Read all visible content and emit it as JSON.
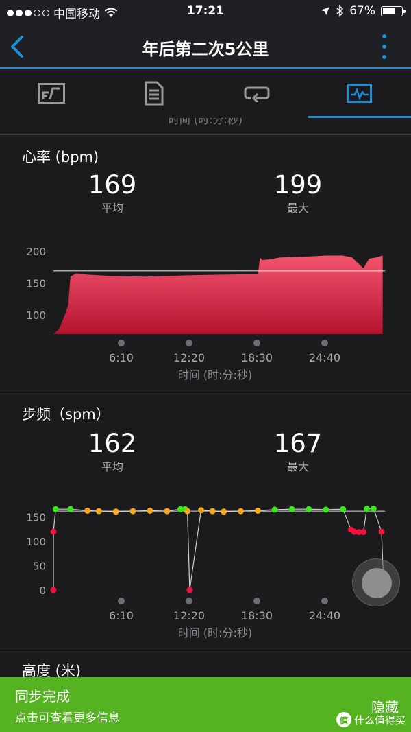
{
  "status_bar": {
    "carrier": "中国移动",
    "time": "17:21",
    "battery": "67%",
    "battery_level": 0.67,
    "icons": [
      "signal-dots-icon",
      "wifi-icon",
      "location-arrow-icon",
      "bluetooth-icon",
      "battery-icon"
    ]
  },
  "header": {
    "title": "年后第二次5公里",
    "back_icon": "chevron-left-icon",
    "more_icon": "more-vertical-icon",
    "accent_color": "#1a8fd8"
  },
  "tabs": [
    {
      "name": "overview",
      "icon": "overview-icon",
      "active": false
    },
    {
      "name": "details",
      "icon": "document-icon",
      "active": false
    },
    {
      "name": "laps",
      "icon": "loop-icon",
      "active": false
    },
    {
      "name": "charts",
      "icon": "chart-icon",
      "active": true
    }
  ],
  "partial_axis_label": "时间 (时:分:秒)",
  "heart_rate": {
    "title": "心率 (bpm)",
    "avg_value": "169",
    "avg_label": "平均",
    "max_value": "199",
    "max_label": "最大",
    "axis_label": "时间 (时:分:秒)"
  },
  "cadence": {
    "title": "步频（spm）",
    "avg_value": "162",
    "avg_label": "平均",
    "max_value": "167",
    "max_label": "最大",
    "axis_label": "时间 (时:分:秒)"
  },
  "elevation": {
    "title": "高度 (米)"
  },
  "banner": {
    "title": "同步完成",
    "subtitle": "点击可查看更多信息",
    "hide_label": "隐藏",
    "watermark": "什么值得买",
    "watermark_icon": "值",
    "background_color": "#55b322"
  },
  "chart_data": [
    {
      "type": "area",
      "title": "心率 (bpm)",
      "xlabel": "时间 (时:分:秒)",
      "ylabel": "",
      "x_ticks": [
        "6:10",
        "12:20",
        "18:30",
        "24:40"
      ],
      "y_ticks": [
        100,
        150,
        200
      ],
      "ylim": [
        70,
        215
      ],
      "xlim_minutes": [
        0,
        29.2
      ],
      "average_line": 169,
      "color": "#e8294f",
      "x_minutes": [
        0.0,
        0.5,
        1.0,
        1.3,
        1.5,
        2.0,
        3.0,
        5.0,
        8.0,
        10.0,
        12.0,
        15.0,
        18.0,
        18.2,
        18.4,
        19.0,
        20.0,
        22.0,
        24.0,
        25.5,
        26.3,
        27.3,
        27.8,
        28.4,
        29.0
      ],
      "values": [
        70,
        78,
        100,
        115,
        160,
        165,
        163,
        161,
        160,
        161,
        162,
        163,
        164,
        190,
        186,
        187,
        190,
        191,
        193,
        193,
        190,
        173,
        188,
        190,
        193
      ]
    },
    {
      "type": "scatter",
      "title": "步频（spm）",
      "xlabel": "时间 (时:分:秒)",
      "ylabel": "",
      "x_ticks": [
        "6:10",
        "12:20",
        "18:30",
        "24:40"
      ],
      "y_ticks": [
        0,
        50,
        100,
        150
      ],
      "ylim": [
        0,
        170
      ],
      "xlim_minutes": [
        0,
        29.2
      ],
      "average_line": 162,
      "color_legend": {
        "high": "#39e616",
        "mid": "#f5a623",
        "low": "#f0143c"
      },
      "x_minutes": [
        0.0,
        0.0,
        0.2,
        1.5,
        3.0,
        4.0,
        5.5,
        7.0,
        8.5,
        10.0,
        11.2,
        11.6,
        11.8,
        12.0,
        13.0,
        14.0,
        15.0,
        16.5,
        18.0,
        19.5,
        21.0,
        22.5,
        24.0,
        25.5,
        26.2,
        26.5,
        26.9,
        27.3,
        27.6,
        28.2,
        28.9,
        29.1
      ],
      "values": [
        0,
        120,
        166,
        166,
        163,
        162,
        161,
        162,
        163,
        162,
        166,
        166,
        162,
        0,
        164,
        162,
        161,
        162,
        163,
        165,
        166,
        166,
        165,
        166,
        124,
        120,
        119,
        119,
        167,
        167,
        120,
        0
      ],
      "point_colors": [
        "low",
        "low",
        "high",
        "high",
        "mid",
        "mid",
        "mid",
        "mid",
        "mid",
        "mid",
        "high",
        "high",
        "mid",
        "low",
        "mid",
        "mid",
        "mid",
        "mid",
        "mid",
        "high",
        "high",
        "high",
        "high",
        "high",
        "low",
        "low",
        "low",
        "low",
        "high",
        "high",
        "low",
        "low"
      ]
    }
  ]
}
